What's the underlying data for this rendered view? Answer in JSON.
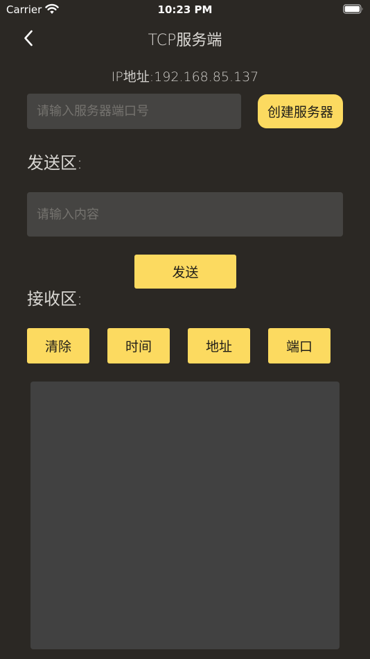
{
  "status_bar": {
    "carrier": "Carrier",
    "time": "10:23 PM"
  },
  "nav": {
    "title": "TCP服务端"
  },
  "server": {
    "ip_label": "IP地址:192.168.85.137",
    "port_placeholder": "请输入服务器端口号",
    "create_label": "创建服务器"
  },
  "send_section": {
    "label": "发送区:",
    "content_placeholder": "请输入内容",
    "send_label": "发送"
  },
  "receive_section": {
    "label": "接收区:",
    "buttons": [
      "清除",
      "时间",
      "地址",
      "端口"
    ]
  },
  "colors": {
    "background": "#2b2824",
    "accent": "#fcda60",
    "field": "#454442"
  }
}
